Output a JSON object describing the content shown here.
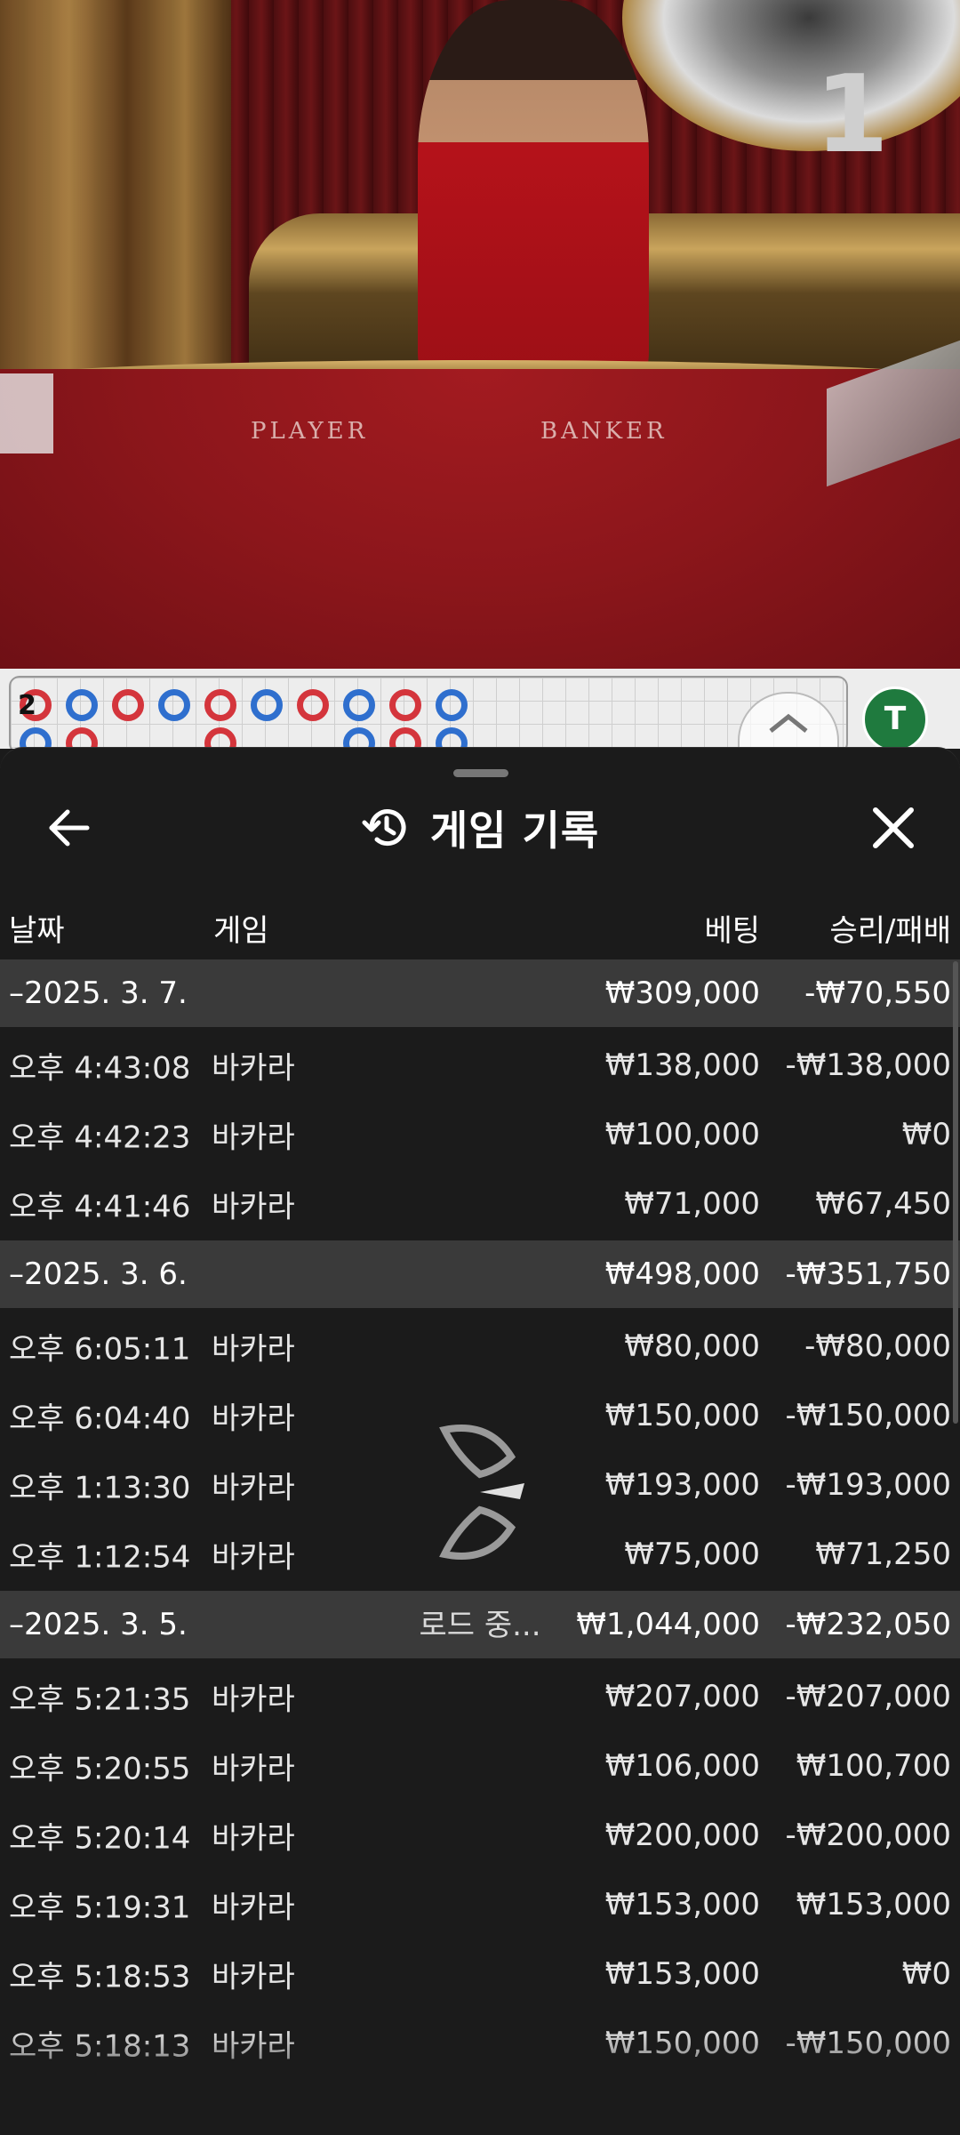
{
  "video": {
    "round_number": "1",
    "player_label": "PLAYER",
    "banker_label": "BANKER"
  },
  "roadmap": {
    "shoe_badge": "2",
    "tie_badge": "T"
  },
  "sheet": {
    "title": "게임 기록",
    "columns": {
      "date": "날짜",
      "game": "게임",
      "bet": "베팅",
      "winloss": "승리/패배"
    },
    "groups": [
      {
        "date": "–2025. 3. 7.",
        "bet": "₩309,000",
        "winloss": "-₩70,550",
        "rows": [
          {
            "time": "오후 4:43:08",
            "game": "바카라",
            "bet": "₩138,000",
            "winloss": "-₩138,000"
          },
          {
            "time": "오후 4:42:23",
            "game": "바카라",
            "bet": "₩100,000",
            "winloss": "₩0"
          },
          {
            "time": "오후 4:41:46",
            "game": "바카라",
            "bet": "₩71,000",
            "winloss": "₩67,450"
          }
        ]
      },
      {
        "date": "–2025. 3. 6.",
        "bet": "₩498,000",
        "winloss": "-₩351,750",
        "rows": [
          {
            "time": "오후 6:05:11",
            "game": "바카라",
            "bet": "₩80,000",
            "winloss": "-₩80,000"
          },
          {
            "time": "오후 6:04:40",
            "game": "바카라",
            "bet": "₩150,000",
            "winloss": "-₩150,000"
          },
          {
            "time": "오후 1:13:30",
            "game": "바카라",
            "bet": "₩193,000",
            "winloss": "-₩193,000"
          },
          {
            "time": "오후 1:12:54",
            "game": "바카라",
            "bet": "₩75,000",
            "winloss": "₩71,250"
          }
        ]
      },
      {
        "date": "–2025. 3. 5.",
        "bet": "₩1,044,000",
        "winloss": "-₩232,050",
        "rows": [
          {
            "time": "오후 5:21:35",
            "game": "바카라",
            "bet": "₩207,000",
            "winloss": "-₩207,000"
          },
          {
            "time": "오후 5:20:55",
            "game": "바카라",
            "bet": "₩106,000",
            "winloss": "₩100,700"
          },
          {
            "time": "오후 5:20:14",
            "game": "바카라",
            "bet": "₩200,000",
            "winloss": "-₩200,000"
          },
          {
            "time": "오후 5:19:31",
            "game": "바카라",
            "bet": "₩153,000",
            "winloss": "₩153,000"
          },
          {
            "time": "오후 5:18:53",
            "game": "바카라",
            "bet": "₩153,000",
            "winloss": "₩0"
          },
          {
            "time": "오후 5:18:13",
            "game": "바카라",
            "bet": "₩150,000",
            "winloss": "-₩150,000"
          }
        ]
      }
    ],
    "loading_text": "로드 중..."
  },
  "icons": {
    "back": "arrow-left-icon",
    "history": "history-clock-icon",
    "close": "close-icon",
    "loader": "loading-spinner-icon",
    "scroll_up": "chevron-up-icon"
  },
  "colors": {
    "sheet_bg": "#1b1b1b",
    "group_bg": "#3a3a3a",
    "player_ring": "#2f6fce",
    "banker_ring": "#d4353c",
    "tie_badge": "#1f7a3e"
  }
}
